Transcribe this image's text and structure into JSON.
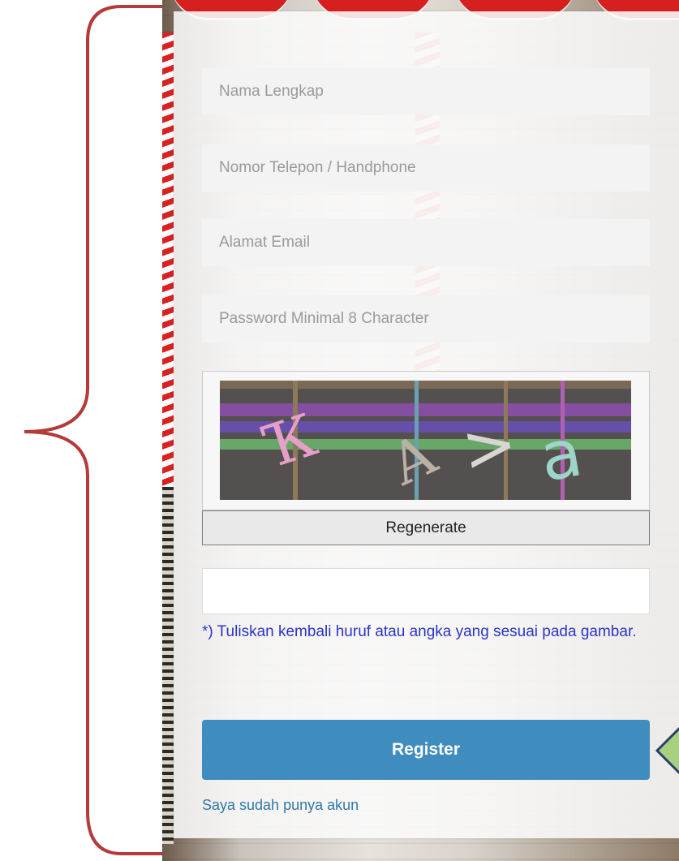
{
  "form": {
    "full_name_placeholder": "Nama Lengkap",
    "phone_placeholder": "Nomor Telepon / Handphone",
    "email_placeholder": "Alamat Email",
    "password_placeholder": "Password Minimal 8 Character",
    "captcha_text": [
      "Ҡ",
      "A",
      ">",
      "a"
    ],
    "regenerate_label": "Regenerate",
    "captcha_hint": "*) Tuliskan kembali huruf atau angka yang sesuai pada gambar.",
    "register_label": "Register",
    "login_link": "Saya sudah punya akun"
  },
  "colors": {
    "register_button": "#3f8cbf",
    "hint_text": "#2a35c7",
    "link": "#2e78a8",
    "annotation": "#b53a3a"
  }
}
